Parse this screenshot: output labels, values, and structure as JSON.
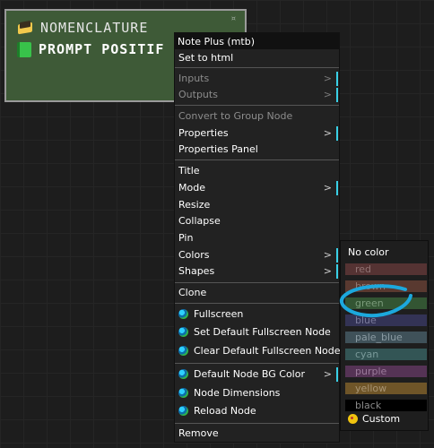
{
  "node": {
    "corner": "¤",
    "line1": "NOMENCLATURE",
    "line2": "PROMPT POSITIF"
  },
  "menu": {
    "title": "Note Plus (mtb)",
    "items": [
      {
        "label": "Set to html"
      },
      {
        "label": "Inputs"
      },
      {
        "label": "Outputs"
      },
      {
        "label": "Convert to Group Node"
      },
      {
        "label": "Properties"
      },
      {
        "label": "Properties Panel"
      },
      {
        "label": "Title"
      },
      {
        "label": "Mode"
      },
      {
        "label": "Resize"
      },
      {
        "label": "Collapse"
      },
      {
        "label": "Pin"
      },
      {
        "label": "Colors"
      },
      {
        "label": "Shapes"
      },
      {
        "label": "Clone"
      },
      {
        "label": "Fullscreen"
      },
      {
        "label": "Set Default Fullscreen Node"
      },
      {
        "label": "Clear Default Fullscreen Node"
      },
      {
        "label": "Default Node BG Color"
      },
      {
        "label": "Node Dimensions"
      },
      {
        "label": "Reload Node"
      },
      {
        "label": "Remove"
      }
    ],
    "arrow": ">"
  },
  "colors_submenu": {
    "no_color": "No color",
    "options": [
      {
        "label": "red",
        "bg": "#553333",
        "fg": "#8f7272"
      },
      {
        "label": "brown",
        "bg": "#593930",
        "fg": "#917a74"
      },
      {
        "label": "green",
        "bg": "#335533",
        "fg": "#7a9a7a"
      },
      {
        "label": "blue",
        "bg": "#333355",
        "fg": "#7a7a9a"
      },
      {
        "label": "pale_blue",
        "bg": "#3f5159",
        "fg": "#8a9aa2"
      },
      {
        "label": "cyan",
        "bg": "#335555",
        "fg": "#7a9a9a"
      },
      {
        "label": "purple",
        "bg": "#553355",
        "fg": "#9a7a9a"
      },
      {
        "label": "yellow",
        "bg": "#6f5528",
        "fg": "#a89473"
      },
      {
        "label": "black",
        "bg": "#000000",
        "fg": "#8a8a8a"
      }
    ],
    "custom": "Custom"
  },
  "colors": {
    "accent_cyan": "#39d0e6",
    "annotation": "#1ca8dd",
    "node_bg": "#3e5a37"
  },
  "icons": {
    "node_icon_1": "book-icon",
    "node_icon_2": "green-book-icon",
    "item_icon": "globe-icon",
    "custom_icon": "palette-icon"
  }
}
